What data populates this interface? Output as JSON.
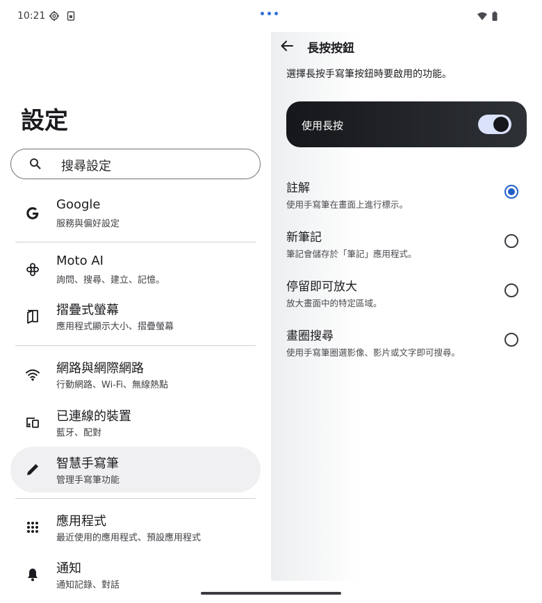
{
  "status_bar": {
    "time": "10:21",
    "left_icons": [
      "gear-icon",
      "sim-icon"
    ],
    "right_icons": [
      "wifi-icon",
      "battery-icon"
    ],
    "accent_dots_color": "#2f6fd8"
  },
  "settings": {
    "title": "設定",
    "search": {
      "placeholder": "搜尋設定",
      "icon": "search-icon"
    },
    "items": [
      {
        "icon": "google-g-icon",
        "title": "Google",
        "subtitle": "服務與偏好設定"
      },
      {
        "icon": "moto-ai-icon",
        "title": "Moto AI",
        "subtitle": "詢問、搜尋、建立、記憶。"
      },
      {
        "icon": "foldable-screen-icon",
        "title": "摺疊式螢幕",
        "subtitle": "應用程式顯示大小、摺疊螢幕"
      },
      {
        "icon": "wifi-icon",
        "title": "網路與網際網路",
        "subtitle": "行動網路、Wi‑Fi、無線熱點"
      },
      {
        "icon": "connected-devices-icon",
        "title": "已連線的裝置",
        "subtitle": "藍牙、配對"
      },
      {
        "icon": "pen-icon",
        "title": "智慧手寫筆",
        "subtitle": "管理手寫筆功能",
        "active": true
      },
      {
        "icon": "apps-grid-icon",
        "title": "應用程式",
        "subtitle": "最近使用的應用程式、預設應用程式"
      },
      {
        "icon": "bell-icon",
        "title": "通知",
        "subtitle": "通知記錄、對話"
      }
    ]
  },
  "detail": {
    "title": "長按按鈕",
    "description": "選擇長按手寫筆按鈕時要啟用的功能。",
    "toggle": {
      "label": "使用長按",
      "on": true
    },
    "options": [
      {
        "title": "註解",
        "subtitle": "使用手寫筆在畫面上進行標示。",
        "selected": true
      },
      {
        "title": "新筆記",
        "subtitle": "筆記會儲存於「筆記」應用程式。",
        "selected": false
      },
      {
        "title": "停留即可放大",
        "subtitle": "放大畫面中的特定區域。",
        "selected": false
      },
      {
        "title": "畫圈搜尋",
        "subtitle": "使用手寫筆圈選影像、影片或文字即可搜尋。",
        "selected": false
      }
    ],
    "accent_color": "#1f5fc6"
  }
}
